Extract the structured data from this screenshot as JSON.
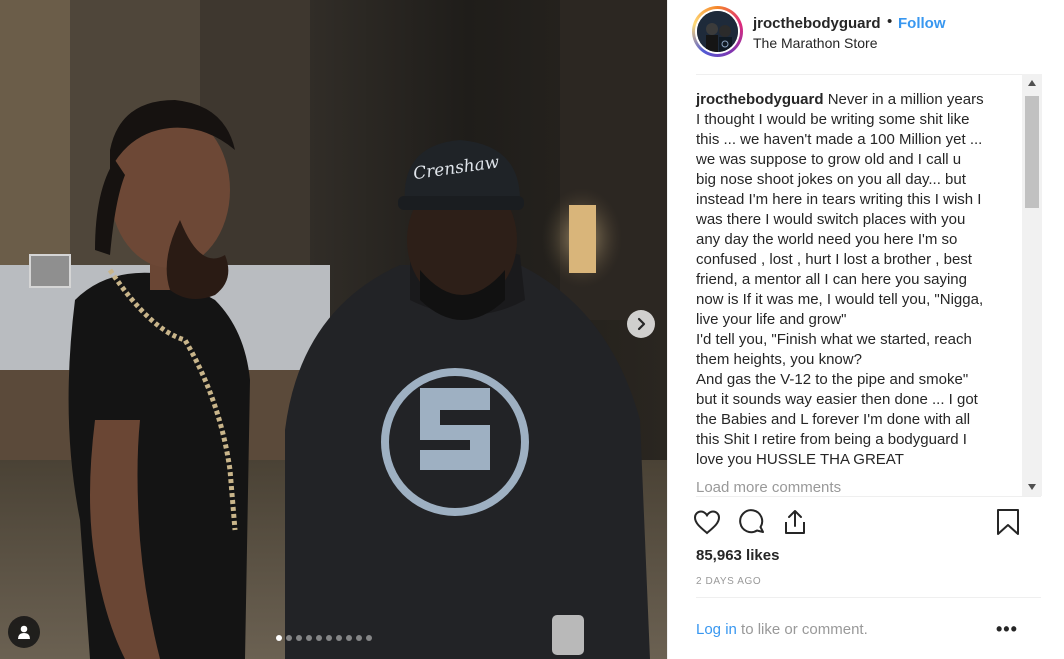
{
  "post": {
    "username": "jrocthebodyguard",
    "bullet": "•",
    "follow_label": "Follow",
    "location": "The Marathon Store",
    "caption_author": "jrocthebodyguard",
    "caption_lines": [
      "Never in a million years",
      "I thought I would be writing some shit like",
      "this ... we haven't made a 100 Million yet ...",
      "we was suppose to grow old and I call u",
      "big nose shoot jokes on you all day... but",
      "instead I'm here in tears writing this I wish I",
      "was there I would switch places with you",
      "any day the world need you here I'm so",
      "confused , lost , hurt I lost a brother , best",
      "friend, a mentor all I can here you saying",
      "now is If it was me, I would tell you, \"Nigga,",
      "live your life and grow\"",
      "I'd tell you, \"Finish what we started, reach",
      "them heights, you know?",
      "And gas the V-12 to the pipe and smoke\"",
      "but it sounds way easier then done ... I got",
      "the Babies and L forever I'm done with all",
      "this Shit I retire from being a bodyguard I",
      "love you HUSSLE THA GREAT"
    ],
    "load_more": "Load more comments",
    "likes": "85,963 likes",
    "age": "2 DAYS AGO",
    "login_link": "Log in",
    "login_suffix": " to like or comment.",
    "more_options": "•••"
  },
  "photo": {
    "hat_text": "Crenshaw",
    "carousel": {
      "count": 10,
      "active_index": 0
    }
  },
  "icons": {
    "like": "heart-icon",
    "comment": "comment-icon",
    "share": "share-icon",
    "save": "bookmark-icon",
    "next": "chevron-right-icon",
    "tags": "user-tag-icon"
  },
  "colors": {
    "link_blue": "#3897f0",
    "text": "#262626",
    "muted": "#999999",
    "divider": "#efefef"
  }
}
